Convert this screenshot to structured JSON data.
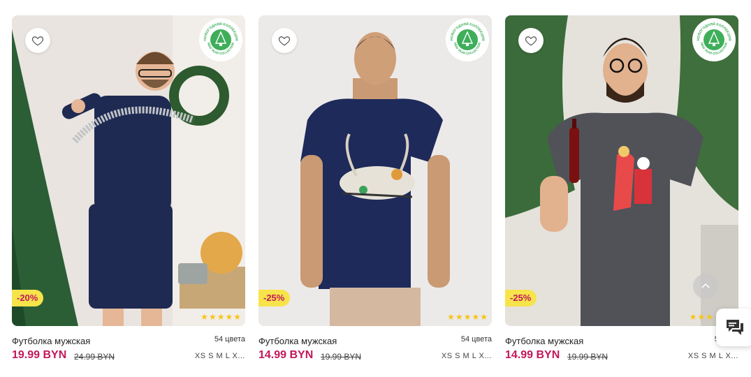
{
  "products": [
    {
      "title": "Футболка мужская",
      "colors": "54 цвета",
      "price": "19.99 BYN",
      "old_price": "24.99 BYN",
      "sizes": "XS S M L X...",
      "discount": "-20%",
      "rating": 5,
      "badge": "new-year-collection-badge"
    },
    {
      "title": "Футболка мужская",
      "colors": "54 цвета",
      "price": "14.99 BYN",
      "old_price": "19.99 BYN",
      "sizes": "XS S M L X...",
      "discount": "-25%",
      "rating": 5,
      "badge": "new-year-collection-badge"
    },
    {
      "title": "Футболка мужская",
      "colors": "54",
      "price": "14.99 BYN",
      "old_price": "19.99 BYN",
      "sizes": "XS S M L X...",
      "discount": "-25%",
      "rating": 5,
      "badge": "new-year-collection-badge"
    }
  ],
  "badge_text": {
    "top": "НОВОГОДНЯЯ КОЛЛЕКЦИЯ",
    "bottom": "NEW YEAR COLLECTION"
  },
  "colors": {
    "price": "#c2185b",
    "discount_bg": "#f7e34a",
    "star": "#f5c518",
    "badge_green": "#3fae5a"
  },
  "icons": {
    "favorite": "heart-icon",
    "scroll_top": "chevron-up-icon",
    "chat": "chat-icon"
  }
}
